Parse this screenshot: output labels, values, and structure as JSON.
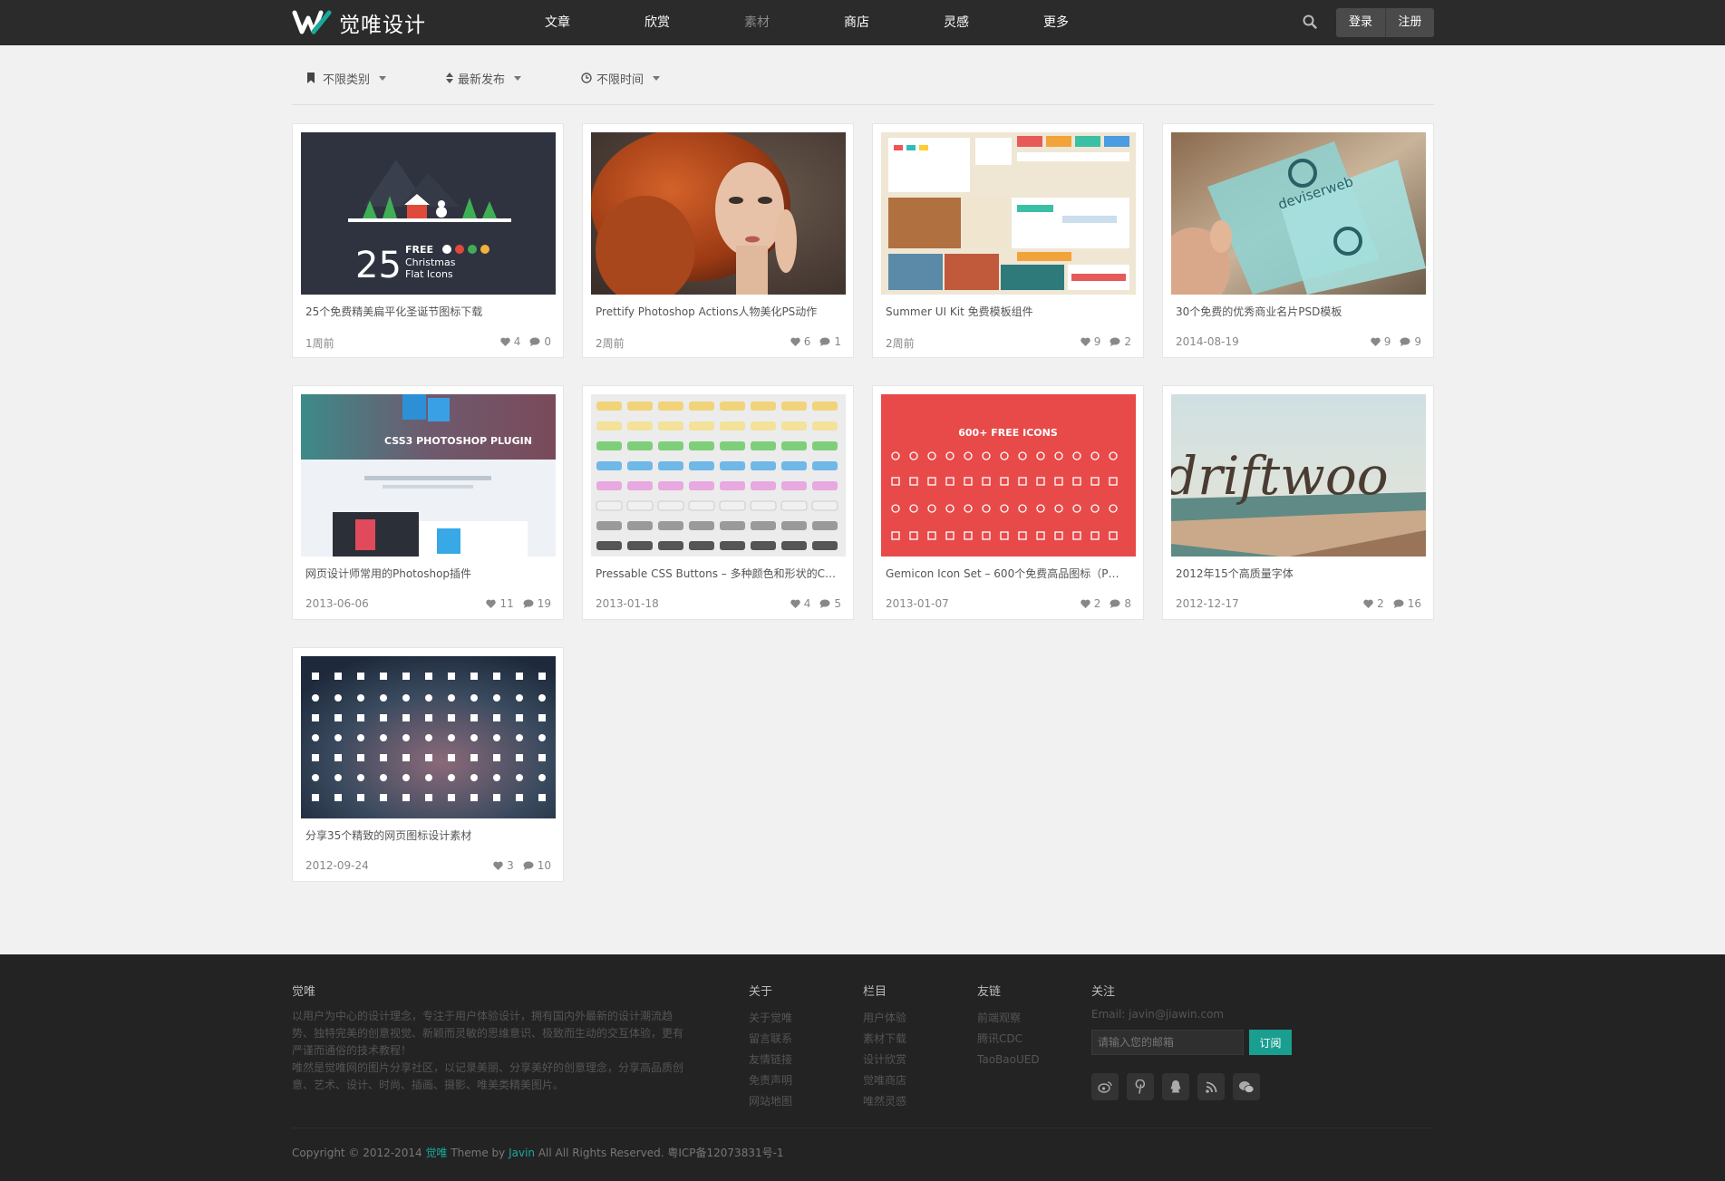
{
  "brand": {
    "name": "觉唯设计",
    "accent": "#1aa99a"
  },
  "nav": {
    "items": [
      "文章",
      "欣赏",
      "素材",
      "商店",
      "灵感",
      "更多"
    ],
    "active_index": 2
  },
  "auth": {
    "login": "登录",
    "register": "注册"
  },
  "filters": {
    "category": "不限类别",
    "sort": "最新发布",
    "time": "不限时间"
  },
  "cards": [
    {
      "title": "25个免费精美扁平化圣诞节图标下载",
      "date": "1周前",
      "likes": "4",
      "comments": "0",
      "image": "christmas-flat-icons"
    },
    {
      "title": "Prettify Photoshop Actions人物美化PS动作",
      "date": "2周前",
      "likes": "6",
      "comments": "1",
      "image": "red-hair-portrait"
    },
    {
      "title": "Summer UI Kit 免费模板组件",
      "date": "2周前",
      "likes": "9",
      "comments": "2",
      "image": "summer-ui-kit"
    },
    {
      "title": "30个免费的优秀商业名片PSD模板",
      "date": "2014-08-19",
      "likes": "9",
      "comments": "9",
      "image": "business-card"
    },
    {
      "title": "网页设计师常用的Photoshop插件",
      "date": "2013-06-06",
      "likes": "11",
      "comments": "19",
      "image": "css3-photoshop-plugin"
    },
    {
      "title": "Pressable CSS Buttons – 多种颜色和形状的CSS…",
      "date": "2013-01-18",
      "likes": "4",
      "comments": "5",
      "image": "css-buttons"
    },
    {
      "title": "Gemicon Icon Set – 600个免费高品图标（P…",
      "date": "2013-01-07",
      "likes": "2",
      "comments": "8",
      "image": "gemicon-icons"
    },
    {
      "title": "2012年15个高质量字体",
      "date": "2012-12-17",
      "likes": "2",
      "comments": "16",
      "image": "driftwood-font"
    },
    {
      "title": "分享35个精致的网页图标设计素材",
      "date": "2012-09-24",
      "likes": "3",
      "comments": "10",
      "image": "web-icons"
    }
  ],
  "thumb_text": {
    "christmas_num": "25",
    "christmas_line1": "FREE",
    "christmas_line2": "Christmas",
    "christmas_line3": "Flat Icons",
    "business_card": "deviserweb",
    "css3ps_title": "CSS3 PHOTOSHOP PLUGIN",
    "gemicon_head": "600+ FREE ICONS",
    "driftwood": "driftwoo"
  },
  "footer": {
    "about": {
      "heading": "觉唯",
      "p1": "以用户为中心的设计理念，专注于用户体验设计，拥有国内外最新的设计潮流趋势、独特完美的创意视觉、新颖而灵敏的思维意识、极致而生动的交互体验，更有严谨而通俗的技术教程！",
      "p2": "唯然是觉唯网的图片分享社区，以记录美丽、分享美好的创意理念，分享高品质创意、艺术、设计、时尚、插画、摄影、唯美类精美图片。"
    },
    "col_about": {
      "heading": "关于",
      "items": [
        "关于觉唯",
        "留言联系",
        "友情链接",
        "免责声明",
        "网站地图"
      ]
    },
    "col_sections": {
      "heading": "栏目",
      "items": [
        "用户体验",
        "素材下载",
        "设计欣赏",
        "觉唯商店",
        "唯然灵感"
      ]
    },
    "col_links": {
      "heading": "友链",
      "items": [
        "前端观察",
        "腾讯CDC",
        "TaoBaoUED"
      ]
    },
    "follow": {
      "heading": "关注",
      "email": "Email: javin@jiawin.com",
      "placeholder": "请输入您的邮箱",
      "button": "订阅"
    },
    "copyright": {
      "pre": "Copyright © 2012-2014 ",
      "site": "觉唯",
      "mid": " Theme by ",
      "author": "Javin",
      "post": " All All Rights Reserved. 粤ICP备12073831号-1"
    }
  }
}
